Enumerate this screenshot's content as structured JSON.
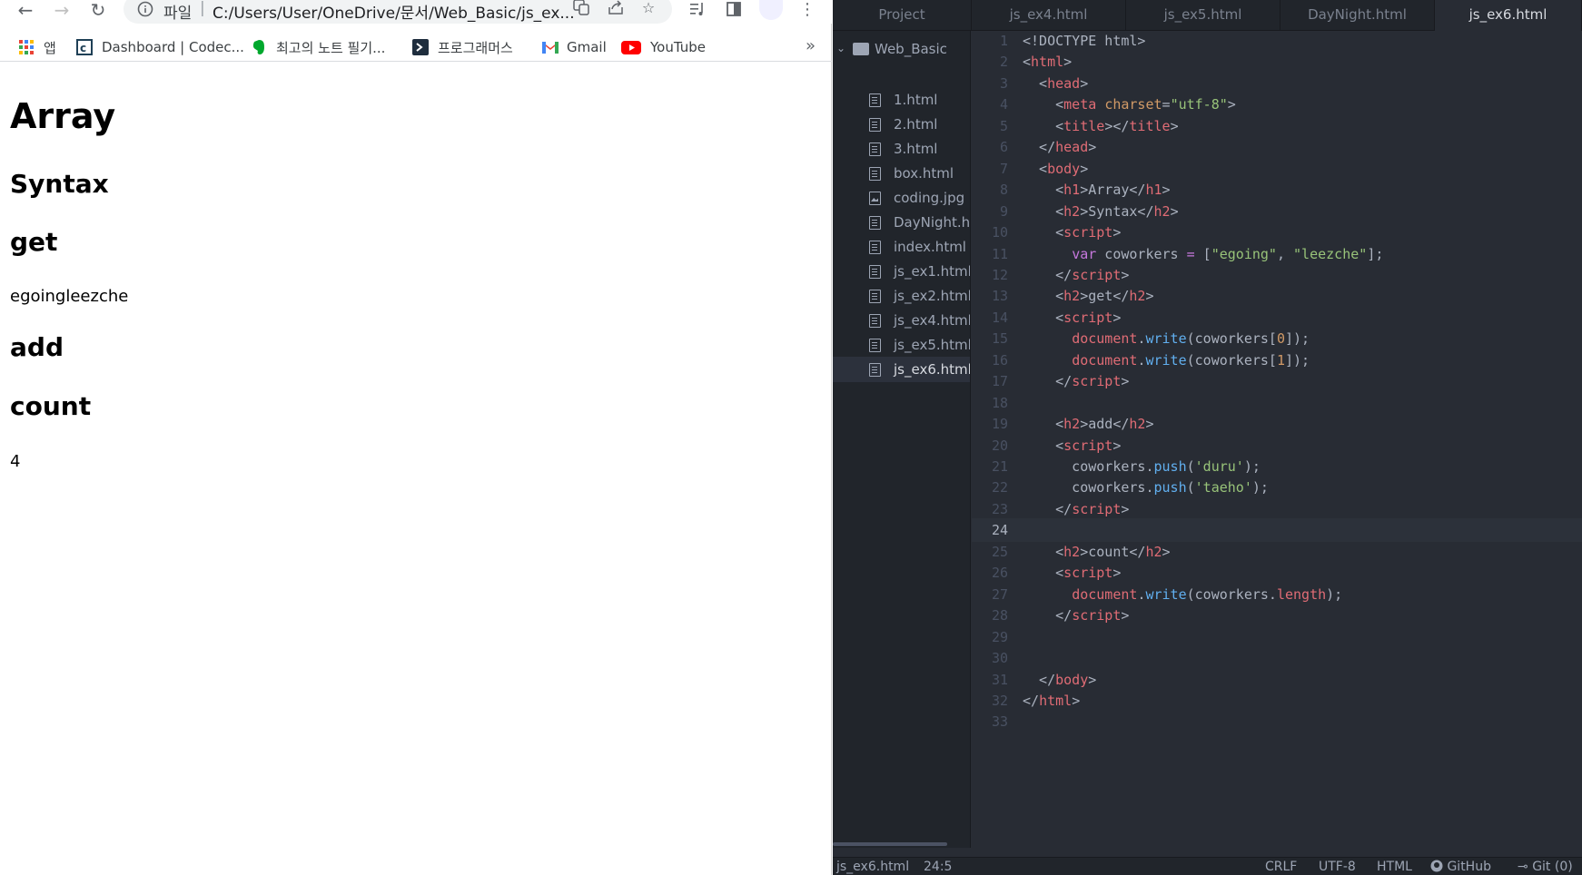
{
  "browser": {
    "address": {
      "site_label": "파일",
      "url": "C:/Users/User/OneDrive/문서/Web_Basic/js_ex..."
    },
    "bookmarks": [
      {
        "label": "앱",
        "icon": "apps-grid-icon"
      },
      {
        "label": "Dashboard | Codec...",
        "icon": "codecademy-icon"
      },
      {
        "label": "최고의 노트 필기...",
        "icon": "evernote-icon"
      },
      {
        "label": "프로그래머스",
        "icon": "programmers-icon"
      },
      {
        "label": "Gmail",
        "icon": "gmail-icon"
      },
      {
        "label": "YouTube",
        "icon": "youtube-icon"
      }
    ],
    "bookmarks_more": "»",
    "page": {
      "h1": "Array",
      "h2_syntax": "Syntax",
      "h2_get": "get",
      "get_output": "egoingleezche",
      "h2_add": "add",
      "h2_count": "count",
      "count_output": "4"
    }
  },
  "editor": {
    "tabs": [
      {
        "label": "Project",
        "active": false
      },
      {
        "label": "js_ex4.html",
        "active": false
      },
      {
        "label": "js_ex5.html",
        "active": false
      },
      {
        "label": "DayNight.html",
        "active": false
      },
      {
        "label": "js_ex6.html",
        "active": true
      }
    ],
    "tree": {
      "root": "Web_Basic",
      "files": [
        {
          "name": "1.html",
          "type": "file"
        },
        {
          "name": "2.html",
          "type": "file"
        },
        {
          "name": "3.html",
          "type": "file"
        },
        {
          "name": "box.html",
          "type": "file"
        },
        {
          "name": "coding.jpg",
          "type": "image"
        },
        {
          "name": "DayNight.html",
          "type": "file"
        },
        {
          "name": "index.html",
          "type": "file"
        },
        {
          "name": "js_ex1.html",
          "type": "file"
        },
        {
          "name": "js_ex2.html",
          "type": "file"
        },
        {
          "name": "js_ex4.html",
          "type": "file"
        },
        {
          "name": "js_ex5.html",
          "type": "file"
        },
        {
          "name": "js_ex6.html",
          "type": "file",
          "selected": true
        }
      ]
    },
    "cursor_line": 24,
    "code_lines": [
      [
        [
          "pl",
          "<!DOCTYPE html>"
        ]
      ],
      [
        [
          "pl",
          "<"
        ],
        [
          "tg",
          "html"
        ],
        [
          "pl",
          ">"
        ]
      ],
      [
        [
          "pl",
          "  <"
        ],
        [
          "tg",
          "head"
        ],
        [
          "pl",
          ">"
        ]
      ],
      [
        [
          "pl",
          "    <"
        ],
        [
          "tg",
          "meta"
        ],
        [
          "pl",
          " "
        ],
        [
          "at",
          "charset"
        ],
        [
          "pl",
          "="
        ],
        [
          "st",
          "\"utf-8\""
        ],
        [
          "pl",
          ">"
        ]
      ],
      [
        [
          "pl",
          "    <"
        ],
        [
          "tg",
          "title"
        ],
        [
          "pl",
          "></"
        ],
        [
          "tg",
          "title"
        ],
        [
          "pl",
          ">"
        ]
      ],
      [
        [
          "pl",
          "  </"
        ],
        [
          "tg",
          "head"
        ],
        [
          "pl",
          ">"
        ]
      ],
      [
        [
          "pl",
          "  <"
        ],
        [
          "tg",
          "body"
        ],
        [
          "pl",
          ">"
        ]
      ],
      [
        [
          "pl",
          "    <"
        ],
        [
          "tg",
          "h1"
        ],
        [
          "pl",
          ">Array</"
        ],
        [
          "tg",
          "h1"
        ],
        [
          "pl",
          ">"
        ]
      ],
      [
        [
          "pl",
          "    <"
        ],
        [
          "tg",
          "h2"
        ],
        [
          "pl",
          ">Syntax</"
        ],
        [
          "tg",
          "h2"
        ],
        [
          "pl",
          ">"
        ]
      ],
      [
        [
          "pl",
          "    <"
        ],
        [
          "tg",
          "script"
        ],
        [
          "pl",
          ">"
        ]
      ],
      [
        [
          "pl",
          "      "
        ],
        [
          "kw",
          "var"
        ],
        [
          "pl",
          " coworkers "
        ],
        [
          "kw",
          "="
        ],
        [
          "pl",
          " ["
        ],
        [
          "st",
          "\"egoing\""
        ],
        [
          "pl",
          ", "
        ],
        [
          "st",
          "\"leezche\""
        ],
        [
          "pl",
          "];"
        ]
      ],
      [
        [
          "pl",
          "    </"
        ],
        [
          "tg",
          "script"
        ],
        [
          "pl",
          ">"
        ]
      ],
      [
        [
          "pl",
          "    <"
        ],
        [
          "tg",
          "h2"
        ],
        [
          "pl",
          ">get</"
        ],
        [
          "tg",
          "h2"
        ],
        [
          "pl",
          ">"
        ]
      ],
      [
        [
          "pl",
          "    <"
        ],
        [
          "tg",
          "script"
        ],
        [
          "pl",
          ">"
        ]
      ],
      [
        [
          "pl",
          "      "
        ],
        [
          "ob",
          "document"
        ],
        [
          "pl",
          "."
        ],
        [
          "fn",
          "write"
        ],
        [
          "pl",
          "(coworkers["
        ],
        [
          "nm",
          "0"
        ],
        [
          "pl",
          "]);"
        ]
      ],
      [
        [
          "pl",
          "      "
        ],
        [
          "ob",
          "document"
        ],
        [
          "pl",
          "."
        ],
        [
          "fn",
          "write"
        ],
        [
          "pl",
          "(coworkers["
        ],
        [
          "nm",
          "1"
        ],
        [
          "pl",
          "]);"
        ]
      ],
      [
        [
          "pl",
          "    </"
        ],
        [
          "tg",
          "script"
        ],
        [
          "pl",
          ">"
        ]
      ],
      [
        [
          "pl",
          ""
        ]
      ],
      [
        [
          "pl",
          "    <"
        ],
        [
          "tg",
          "h2"
        ],
        [
          "pl",
          ">add</"
        ],
        [
          "tg",
          "h2"
        ],
        [
          "pl",
          ">"
        ]
      ],
      [
        [
          "pl",
          "    <"
        ],
        [
          "tg",
          "script"
        ],
        [
          "pl",
          ">"
        ]
      ],
      [
        [
          "pl",
          "      coworkers."
        ],
        [
          "fn",
          "push"
        ],
        [
          "pl",
          "("
        ],
        [
          "st",
          "'duru'"
        ],
        [
          "pl",
          ");"
        ]
      ],
      [
        [
          "pl",
          "      coworkers."
        ],
        [
          "fn",
          "push"
        ],
        [
          "pl",
          "("
        ],
        [
          "st",
          "'taeho'"
        ],
        [
          "pl",
          ");"
        ]
      ],
      [
        [
          "pl",
          "    </"
        ],
        [
          "tg",
          "script"
        ],
        [
          "pl",
          ">"
        ]
      ],
      [
        [
          "pl",
          ""
        ]
      ],
      [
        [
          "pl",
          "    <"
        ],
        [
          "tg",
          "h2"
        ],
        [
          "pl",
          ">count</"
        ],
        [
          "tg",
          "h2"
        ],
        [
          "pl",
          ">"
        ]
      ],
      [
        [
          "pl",
          "    <"
        ],
        [
          "tg",
          "script"
        ],
        [
          "pl",
          ">"
        ]
      ],
      [
        [
          "pl",
          "      "
        ],
        [
          "ob",
          "document"
        ],
        [
          "pl",
          "."
        ],
        [
          "fn",
          "write"
        ],
        [
          "pl",
          "(coworkers."
        ],
        [
          "ob",
          "length"
        ],
        [
          "pl",
          ");"
        ]
      ],
      [
        [
          "pl",
          "    </"
        ],
        [
          "tg",
          "script"
        ],
        [
          "pl",
          ">"
        ]
      ],
      [
        [
          "pl",
          ""
        ]
      ],
      [
        [
          "pl",
          ""
        ]
      ],
      [
        [
          "pl",
          "  </"
        ],
        [
          "tg",
          "body"
        ],
        [
          "pl",
          ">"
        ]
      ],
      [
        [
          "pl",
          "</"
        ],
        [
          "tg",
          "html"
        ],
        [
          "pl",
          ">"
        ]
      ],
      [
        [
          "pl",
          ""
        ]
      ]
    ],
    "status": {
      "file": "js_ex6.html",
      "position": "24:5",
      "line_ending": "CRLF",
      "encoding": "UTF-8",
      "grammar": "HTML",
      "github": "GitHub",
      "git": "Git (0)"
    }
  }
}
